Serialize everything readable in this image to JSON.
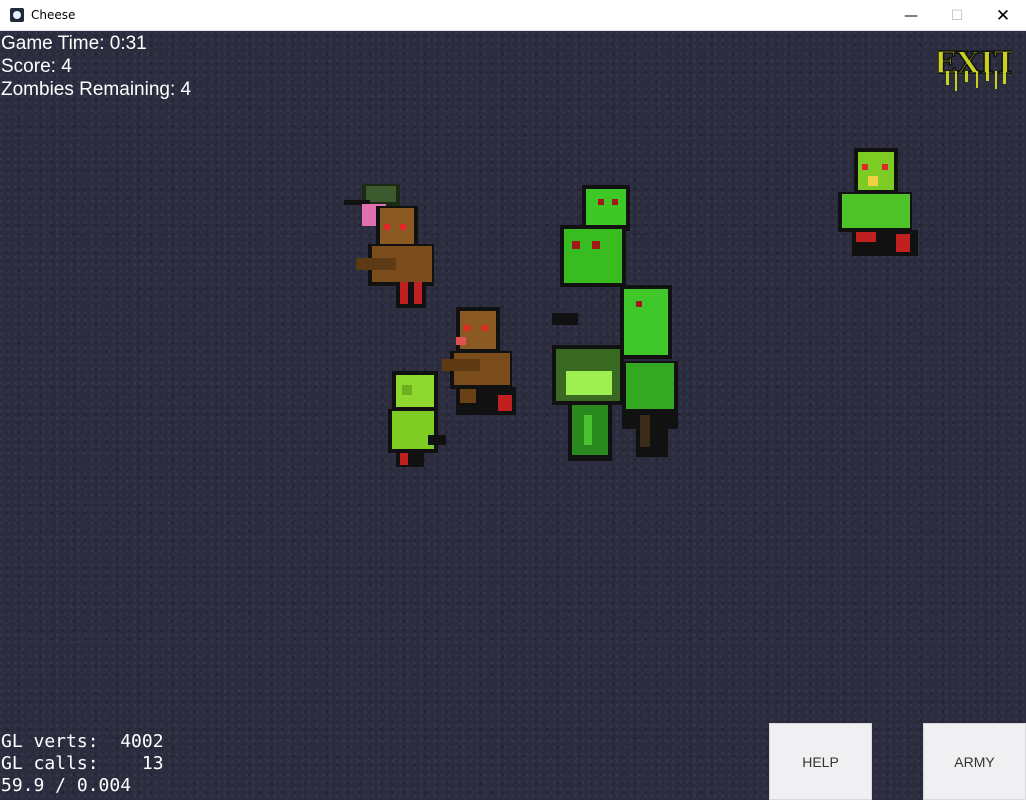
{
  "window": {
    "title": "Cheese",
    "minimize_glyph": "—",
    "maximize_glyph": "☐",
    "close_glyph": "✕"
  },
  "hud": {
    "game_time": "Game Time: 0:31",
    "score": "Score: 4",
    "zombies_remaining": "Zombies Remaining: 4"
  },
  "exit_button": {
    "label": "EXIT",
    "color": "#c8d020"
  },
  "debug": {
    "gl_verts": "GL verts:  4002",
    "gl_calls": "GL calls:    13",
    "fps": "59.9 / 0.004"
  },
  "buttons": {
    "help": "HELP",
    "army": "ARMY"
  },
  "colors": {
    "background": "#2c2c3f",
    "zombie_green": "#4ec428",
    "zombie_brown": "#8a5a22",
    "eye_red": "#e02828"
  }
}
